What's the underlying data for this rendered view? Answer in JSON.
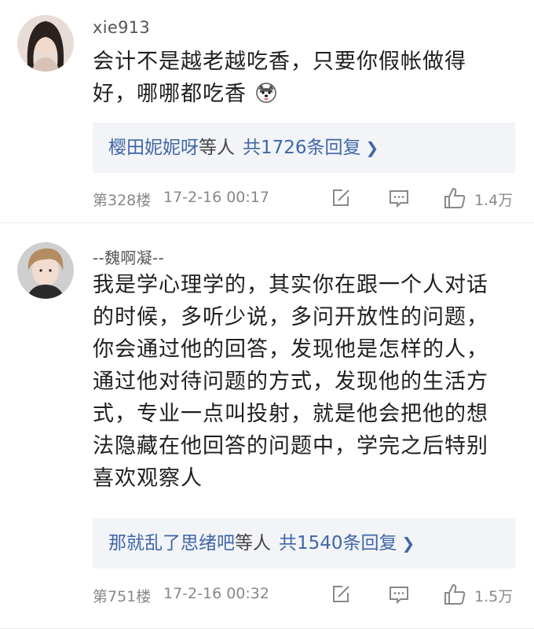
{
  "comments": [
    {
      "username": "xie913",
      "content": "会计不是越老越吃香，只要你假帐做得好，哪哪都吃香",
      "emoji_icon": "husky-dog-emoji",
      "reply_names": "樱田妮妮呀",
      "reply_suffix": "等人",
      "reply_count": "共1726条回复",
      "floor": "第328楼",
      "time": "17-2-16 00:17",
      "likes": "1.4万"
    },
    {
      "username": "--魏啊凝--",
      "content": "我是学心理学的，其实你在跟一个人对话的时候，多听少说，多问开放性的问题，你会通过他的回答，发现他是怎样的人，通过他对待问题的方式，发现他的生活方式，专业一点叫投射，就是他会把他的想法隐藏在他回答的问题中，学完之后特别喜欢观察人",
      "reply_names": "那就乱了思绪吧",
      "reply_suffix": "等人",
      "reply_count": "共1540条回复",
      "floor": "第751楼",
      "time": "17-2-16 00:32",
      "likes": "1.5万"
    }
  ],
  "icons": {
    "edit": "edit-square-icon",
    "comment": "comment-bubble-icon",
    "like": "thumbs-up-icon",
    "chevron": "chevron-right-icon"
  },
  "colors": {
    "link": "#3f66a8",
    "reply_bg": "#f2f4f7",
    "meta": "#888888"
  }
}
